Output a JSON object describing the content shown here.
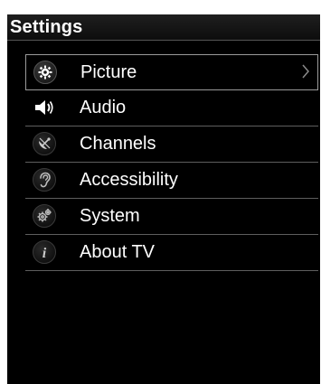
{
  "header": {
    "title": "Settings"
  },
  "menu": {
    "items": [
      {
        "label": "Picture",
        "icon": "picture-gear-icon",
        "selected": true
      },
      {
        "label": "Audio",
        "icon": "speaker-icon",
        "selected": false
      },
      {
        "label": "Channels",
        "icon": "satellite-dish-icon",
        "selected": false
      },
      {
        "label": "Accessibility",
        "icon": "ear-icon",
        "selected": false
      },
      {
        "label": "System",
        "icon": "gears-icon",
        "selected": false
      },
      {
        "label": "About TV",
        "icon": "info-icon",
        "selected": false
      }
    ]
  },
  "colors": {
    "background": "#000000",
    "text": "#ffffff",
    "divider": "#5e5e5e",
    "selection_border": "#9a9a9a"
  }
}
